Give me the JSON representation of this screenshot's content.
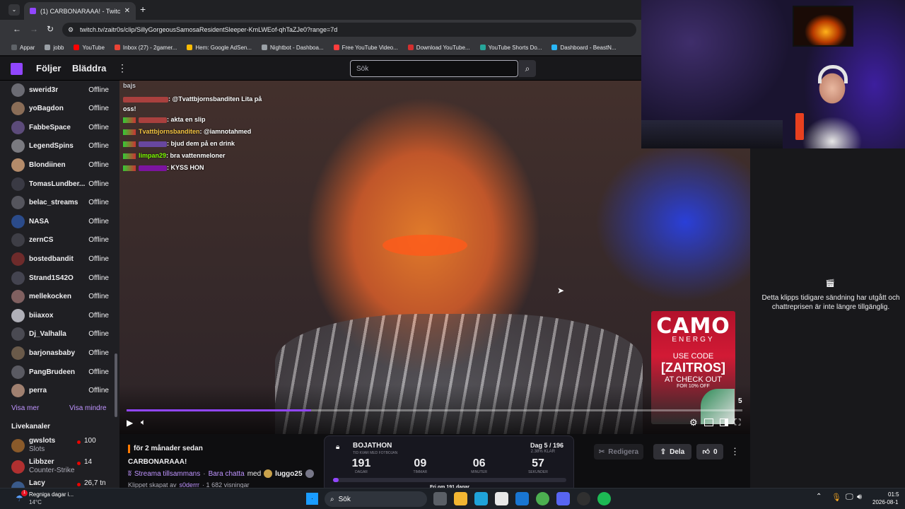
{
  "browser": {
    "tab_title": "(1) CARBONARAAA! - Twitc",
    "url": "twitch.tv/zaitr0s/clip/SillyGorgeousSamosaResidentSleeper-KmLWEof-qhTaZJe0?range=7d",
    "bookmarks": [
      {
        "label": "Appar",
        "color": "#5f6368"
      },
      {
        "label": "jobb",
        "color": "#9aa0a6"
      },
      {
        "label": "YouTube",
        "color": "#ff0000"
      },
      {
        "label": "Inbox (27) - 2gamer...",
        "color": "#ea4335"
      },
      {
        "label": "Hem: Google AdSen...",
        "color": "#fbbc04"
      },
      {
        "label": "Nightbot - Dashboa...",
        "color": "#9aa0a6"
      },
      {
        "label": "Free YouTube Video...",
        "color": "#ff3d3d"
      },
      {
        "label": "Download YouTube...",
        "color": "#d32f2f"
      },
      {
        "label": "YouTube Shorts Do...",
        "color": "#26a69a"
      },
      {
        "label": "Dashboard - BeastN...",
        "color": "#29b6f6"
      }
    ]
  },
  "twitch_nav": {
    "following": "Följer",
    "browse": "Bläddra",
    "search_placeholder": "Sök"
  },
  "sidebar": {
    "channels": [
      {
        "name": "swerid3r",
        "status": "Offline"
      },
      {
        "name": "yoBagdon",
        "status": "Offline"
      },
      {
        "name": "FabbeSpace",
        "status": "Offline"
      },
      {
        "name": "LegendSpins",
        "status": "Offline"
      },
      {
        "name": "Blondiinen",
        "status": "Offline"
      },
      {
        "name": "TomasLundber...",
        "status": "Offline"
      },
      {
        "name": "belac_streams",
        "status": "Offline"
      },
      {
        "name": "NASA",
        "status": "Offline"
      },
      {
        "name": "zernCS",
        "status": "Offline"
      },
      {
        "name": "bostedbandit",
        "status": "Offline"
      },
      {
        "name": "Strand1S42O",
        "status": "Offline"
      },
      {
        "name": "mellekocken",
        "status": "Offline"
      },
      {
        "name": "biiaxox",
        "status": "Offline"
      },
      {
        "name": "Dj_Valhalla",
        "status": "Offline"
      },
      {
        "name": "barjonasbaby",
        "status": "Offline"
      },
      {
        "name": "PangBrudeen",
        "status": "Offline"
      },
      {
        "name": "perra",
        "status": "Offline"
      }
    ],
    "show_more": "Visa mer",
    "show_less": "Visa mindre",
    "live_heading": "Livekanaler",
    "live": [
      {
        "name": "gwslots",
        "category": "Slots",
        "viewers": "100"
      },
      {
        "name": "Libbzer",
        "category": "Counter-Strike",
        "viewers": "14"
      },
      {
        "name": "Lacy",
        "category": "",
        "viewers": "26,7 tn"
      }
    ]
  },
  "chat_overlay": [
    {
      "user": "",
      "text": "bajs"
    },
    {
      "user": "",
      "text": ": @Tvattbjornsbanditen Lita på oss!"
    },
    {
      "user": "",
      "text": ": akta en slip"
    },
    {
      "user": "Tvattbjornsbanditen",
      "text": ": @iamnotahmed"
    },
    {
      "user": "",
      "text": ": bjud dem på en drink"
    },
    {
      "user": "limpan29",
      "text": ": bra vattenmeloner"
    },
    {
      "user": "",
      "text": ": KYSS HON"
    }
  ],
  "ad": {
    "brand": "CAMO",
    "sub": "ENERGY",
    "use_code": "USE CODE",
    "code": "[ZAITROS]",
    "checkout": "AT CHECK OUT",
    "discount": "FOR 10% OFF",
    "count": "5"
  },
  "player": {
    "progress": 0.3
  },
  "clip": {
    "age": "för 2 månader sedan",
    "title": "CARBONARAAA!",
    "stream_together": "Streama tillsammans",
    "just_chat": "Bara chatta",
    "with": "med",
    "collab": "luggo25",
    "clipped_by_prefix": "Klippet skapat av",
    "clipped_by": "s0derrr",
    "views": "· 1 682 visningar",
    "edit": "Redigera",
    "share": "Dela",
    "likes": "0"
  },
  "bojathon": {
    "title": "BOJATHON",
    "subtitle": "TID KVAR MED FOTBOJAN",
    "day": "Dag 5 / 196",
    "percent": "2.38% KLAR",
    "units": [
      {
        "value": "191",
        "label": "DAGAR"
      },
      {
        "value": "09",
        "label": "TIMMAR"
      },
      {
        "value": "06",
        "label": "MINUTER"
      },
      {
        "value": "57",
        "label": "SEKUNDER"
      }
    ],
    "progress": 0.0238,
    "free_in": "Fri om 191 dagar"
  },
  "chat_panel": {
    "message": "Detta klipps tidigare sändning har utgått och chattreprisen är inte längre tillgänglig."
  },
  "taskbar": {
    "weather_title": "Regniga dagar i...",
    "weather_temp": "14°C",
    "search": "Sök",
    "time": "01:5",
    "date": "2026-08-1"
  }
}
